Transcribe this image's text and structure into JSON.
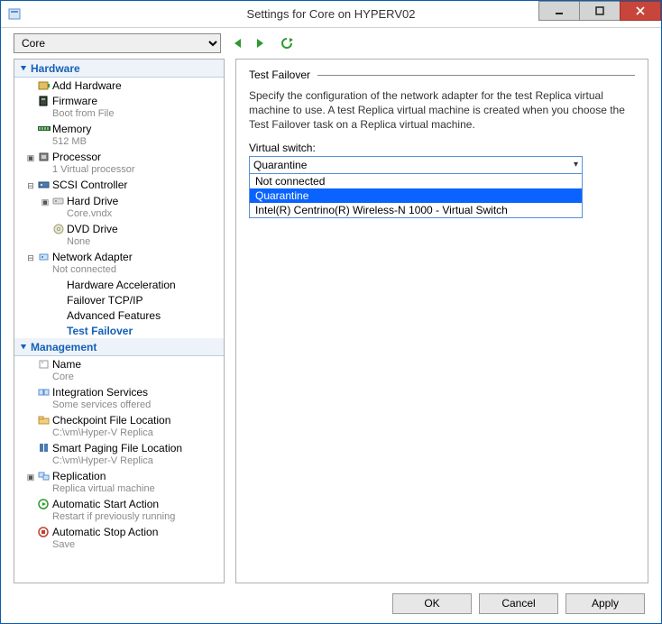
{
  "window": {
    "title": "Settings for Core on HYPERV02"
  },
  "toolbar": {
    "vm_selected": "Core"
  },
  "sidebar": {
    "hardware": {
      "header": "Hardware",
      "items": [
        {
          "label": "Add Hardware",
          "sub": ""
        },
        {
          "label": "Firmware",
          "sub": "Boot from File"
        },
        {
          "label": "Memory",
          "sub": "512 MB"
        },
        {
          "label": "Processor",
          "sub": "1 Virtual processor",
          "expandable": true,
          "expanded": false
        },
        {
          "label": "SCSI Controller",
          "sub": "",
          "expandable": true,
          "expanded": true,
          "children": [
            {
              "label": "Hard Drive",
              "sub": "Core.vndx",
              "expandable": true,
              "expanded": false
            },
            {
              "label": "DVD Drive",
              "sub": "None"
            }
          ]
        },
        {
          "label": "Network Adapter",
          "sub": "Not connected",
          "expandable": true,
          "expanded": true,
          "children": [
            {
              "label": "Hardware Acceleration"
            },
            {
              "label": "Failover TCP/IP"
            },
            {
              "label": "Advanced Features"
            },
            {
              "label": "Test Failover",
              "selected": true
            }
          ]
        }
      ]
    },
    "management": {
      "header": "Management",
      "items": [
        {
          "label": "Name",
          "sub": "Core"
        },
        {
          "label": "Integration Services",
          "sub": "Some services offered"
        },
        {
          "label": "Checkpoint File Location",
          "sub": "C:\\vm\\Hyper-V Replica"
        },
        {
          "label": "Smart Paging File Location",
          "sub": "C:\\vm\\Hyper-V Replica"
        },
        {
          "label": "Replication",
          "sub": "Replica virtual machine",
          "expandable": true,
          "expanded": false
        },
        {
          "label": "Automatic Start Action",
          "sub": "Restart if previously running"
        },
        {
          "label": "Automatic Stop Action",
          "sub": "Save"
        }
      ]
    }
  },
  "detail": {
    "title": "Test Failover",
    "description": "Specify the configuration of the network adapter for the test Replica virtual machine to use. A test Replica virtual machine is created when you choose the Test Failover task on a Replica virtual machine.",
    "field_label": "Virtual switch:",
    "combo_value": "Quarantine",
    "options": [
      "Not connected",
      "Quarantine",
      "Intel(R) Centrino(R) Wireless-N 1000 - Virtual Switch"
    ],
    "highlighted_option_index": 1
  },
  "buttons": {
    "ok": "OK",
    "cancel": "Cancel",
    "apply": "Apply"
  }
}
